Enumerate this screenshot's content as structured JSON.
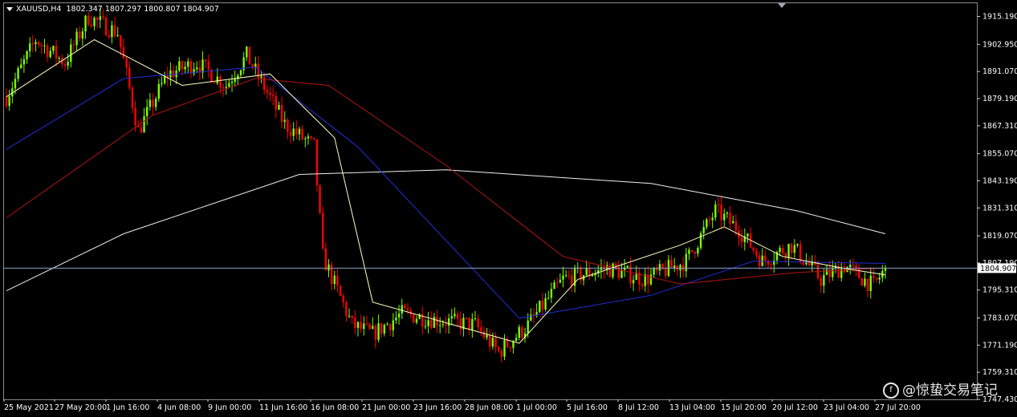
{
  "header": {
    "symbol": "XAUUSD,H4",
    "ohlc": "1802.347 1807.297 1800.807 1804.907"
  },
  "price_label": "1804.907",
  "watermark": "@惊蛰交易笔记",
  "colors": {
    "background": "#000000",
    "bull_candle": "#7CFC00",
    "bear_candle": "#FF0000",
    "ma_blue": "#1f2fd6",
    "ma_red": "#b01414",
    "ma_white": "#f0f0f0",
    "ma_yellow": "#ffffc0",
    "price_line": "#8aa6c8",
    "axis_text": "#ffffff"
  },
  "chart_data": {
    "type": "candlestick",
    "title": "XAUUSD,H4",
    "y_ticks": [
      "1915.190",
      "1902.950",
      "1891.070",
      "1879.190",
      "1867.310",
      "1855.070",
      "1843.190",
      "1831.310",
      "1819.070",
      "1807.190",
      "1795.310",
      "1783.070",
      "1771.190",
      "1759.310",
      "1747.430"
    ],
    "x_ticks": [
      "25 May 2021",
      "27 May 20:00",
      "1 Jun 16:00",
      "4 Jun 08:00",
      "9 Jun 00:00",
      "11 Jun 16:00",
      "16 Jun 08:00",
      "21 Jun 00:00",
      "23 Jun 16:00",
      "28 Jun 08:00",
      "1 Jul 00:00",
      "5 Jul 16:00",
      "8 Jul 12:00",
      "13 Jul 04:00",
      "15 Jul 20:00",
      "20 Jul 12:00",
      "23 Jul 04:00",
      "27 Jul 20:00"
    ],
    "ylim": [
      1747.43,
      1921
    ],
    "current_price": 1804.907,
    "key_points": [
      {
        "i": 0,
        "p": 1880
      },
      {
        "i": 10,
        "p": 1905
      },
      {
        "i": 20,
        "p": 1895
      },
      {
        "i": 28,
        "p": 1915
      },
      {
        "i": 38,
        "p": 1908
      },
      {
        "i": 45,
        "p": 1865
      },
      {
        "i": 55,
        "p": 1890
      },
      {
        "i": 65,
        "p": 1895
      },
      {
        "i": 75,
        "p": 1885
      },
      {
        "i": 82,
        "p": 1898
      },
      {
        "i": 95,
        "p": 1868
      },
      {
        "i": 105,
        "p": 1858
      },
      {
        "i": 108,
        "p": 1810
      },
      {
        "i": 118,
        "p": 1780
      },
      {
        "i": 125,
        "p": 1776
      },
      {
        "i": 135,
        "p": 1785
      },
      {
        "i": 148,
        "p": 1782
      },
      {
        "i": 160,
        "p": 1780
      },
      {
        "i": 168,
        "p": 1768
      },
      {
        "i": 178,
        "p": 1780
      },
      {
        "i": 190,
        "p": 1800
      },
      {
        "i": 205,
        "p": 1805
      },
      {
        "i": 218,
        "p": 1800
      },
      {
        "i": 232,
        "p": 1808
      },
      {
        "i": 242,
        "p": 1830
      },
      {
        "i": 250,
        "p": 1822
      },
      {
        "i": 258,
        "p": 1808
      },
      {
        "i": 268,
        "p": 1815
      },
      {
        "i": 278,
        "p": 1800
      },
      {
        "i": 286,
        "p": 1806
      },
      {
        "i": 296,
        "p": 1797
      },
      {
        "i": 300,
        "p": 1805
      }
    ],
    "moving_averages": [
      {
        "color": "ma_white",
        "points": [
          [
            0,
            1795
          ],
          [
            40,
            1820
          ],
          [
            100,
            1846
          ],
          [
            150,
            1848
          ],
          [
            220,
            1842
          ],
          [
            270,
            1830
          ],
          [
            300,
            1820
          ]
        ]
      },
      {
        "color": "ma_blue",
        "points": [
          [
            0,
            1857
          ],
          [
            40,
            1888
          ],
          [
            85,
            1893
          ],
          [
            120,
            1858
          ],
          [
            175,
            1783
          ],
          [
            220,
            1793
          ],
          [
            255,
            1808
          ],
          [
            300,
            1807
          ]
        ]
      },
      {
        "color": "ma_red",
        "points": [
          [
            0,
            1827
          ],
          [
            50,
            1872
          ],
          [
            85,
            1888
          ],
          [
            110,
            1885
          ],
          [
            150,
            1850
          ],
          [
            190,
            1810
          ],
          [
            230,
            1798
          ],
          [
            270,
            1803
          ],
          [
            300,
            1805
          ]
        ]
      },
      {
        "color": "ma_yellow",
        "points": [
          [
            0,
            1880
          ],
          [
            30,
            1905
          ],
          [
            60,
            1885
          ],
          [
            90,
            1890
          ],
          [
            112,
            1862
          ],
          [
            125,
            1790
          ],
          [
            150,
            1781
          ],
          [
            175,
            1772
          ],
          [
            195,
            1800
          ],
          [
            230,
            1815
          ],
          [
            245,
            1823
          ],
          [
            265,
            1810
          ],
          [
            285,
            1805
          ],
          [
            300,
            1802
          ]
        ]
      }
    ]
  }
}
